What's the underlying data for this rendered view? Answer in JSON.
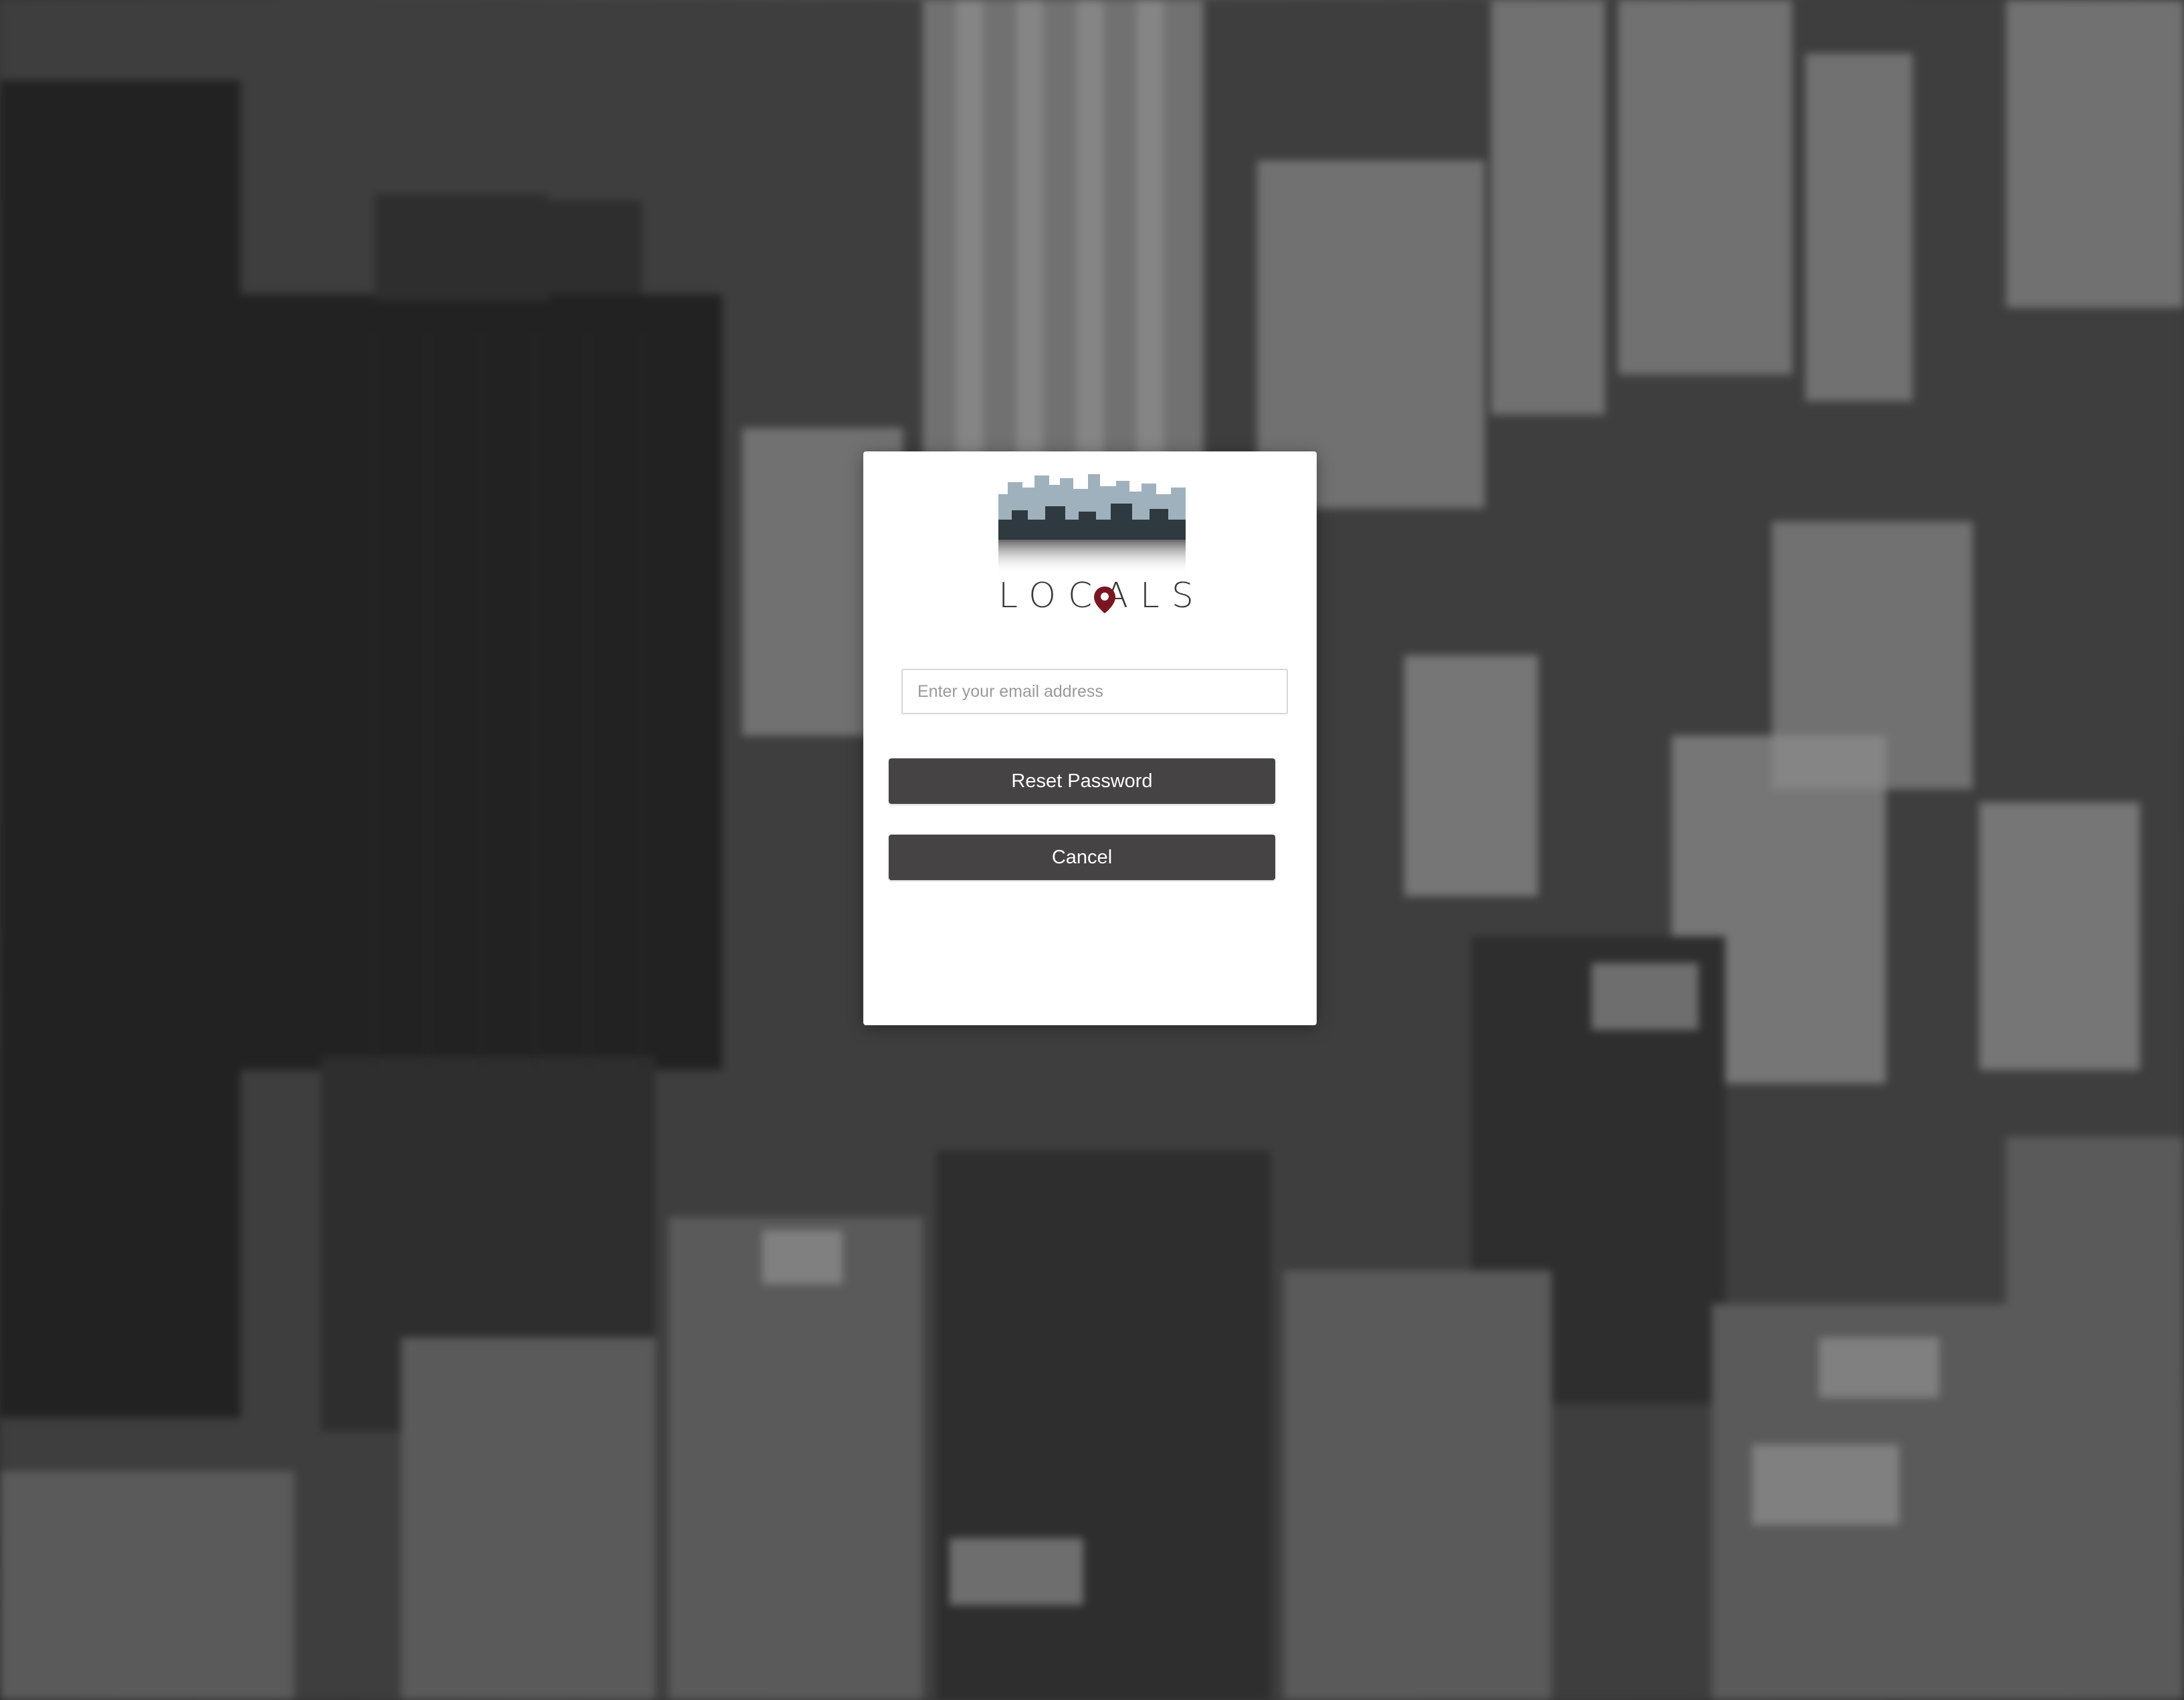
{
  "background": {
    "description_color": "#3d3d3d"
  },
  "card": {
    "logo": {
      "wordmark": "LOCALS",
      "pin_color": "#8b1a1a"
    },
    "email_input": {
      "value": "",
      "placeholder": "Enter your email address"
    },
    "reset_button_label": "Reset Password",
    "cancel_button_label": "Cancel"
  }
}
